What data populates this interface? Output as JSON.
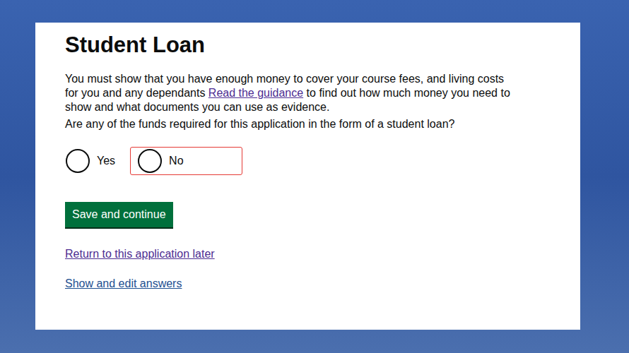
{
  "page": {
    "title": "Student Loan",
    "intro": {
      "before": "You must show that you have enough money to cover your course fees, and living costs for you and any dependants ",
      "link": "Read the guidance",
      "after": " to find out how much money you need to show and what documents you can use as evidence."
    },
    "question": "Are any of the funds required for this application in the form of a student loan?",
    "options": [
      {
        "label": "Yes",
        "selected": false,
        "highlighted": false
      },
      {
        "label": "No",
        "selected": false,
        "highlighted": true
      }
    ],
    "button": "Save and continue",
    "links": [
      {
        "label": "Return to this application later",
        "visited": true
      },
      {
        "label": "Show and edit answers",
        "visited": false
      }
    ]
  }
}
